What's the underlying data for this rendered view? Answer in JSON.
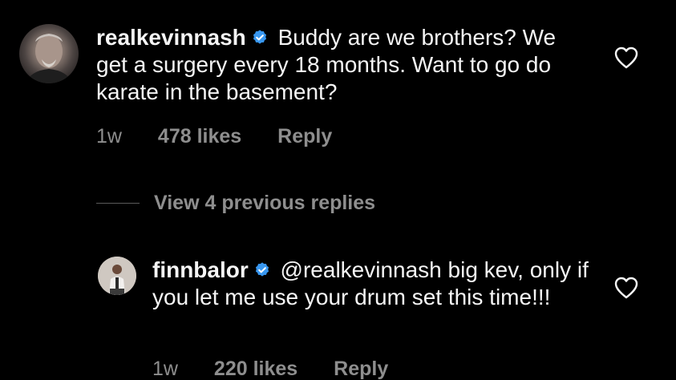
{
  "comments": [
    {
      "username": "realkevinnash",
      "verified": true,
      "text": "Buddy are we brothers? We get a surgery every 18 months. Want to go do karate in the basement?",
      "time": "1w",
      "likes": "478 likes",
      "reply": "Reply"
    },
    {
      "username": "finnbalor",
      "verified": true,
      "text": "@realkevinnash big kev, only if you let me use your drum set this time!!!",
      "time": "1w",
      "likes": "220 likes",
      "reply": "Reply"
    }
  ],
  "view_replies": "View 4 previous replies",
  "colors": {
    "background": "#000000",
    "text": "#f5f5f5",
    "secondary": "#8e8e8e",
    "verified": "#3897f0"
  }
}
